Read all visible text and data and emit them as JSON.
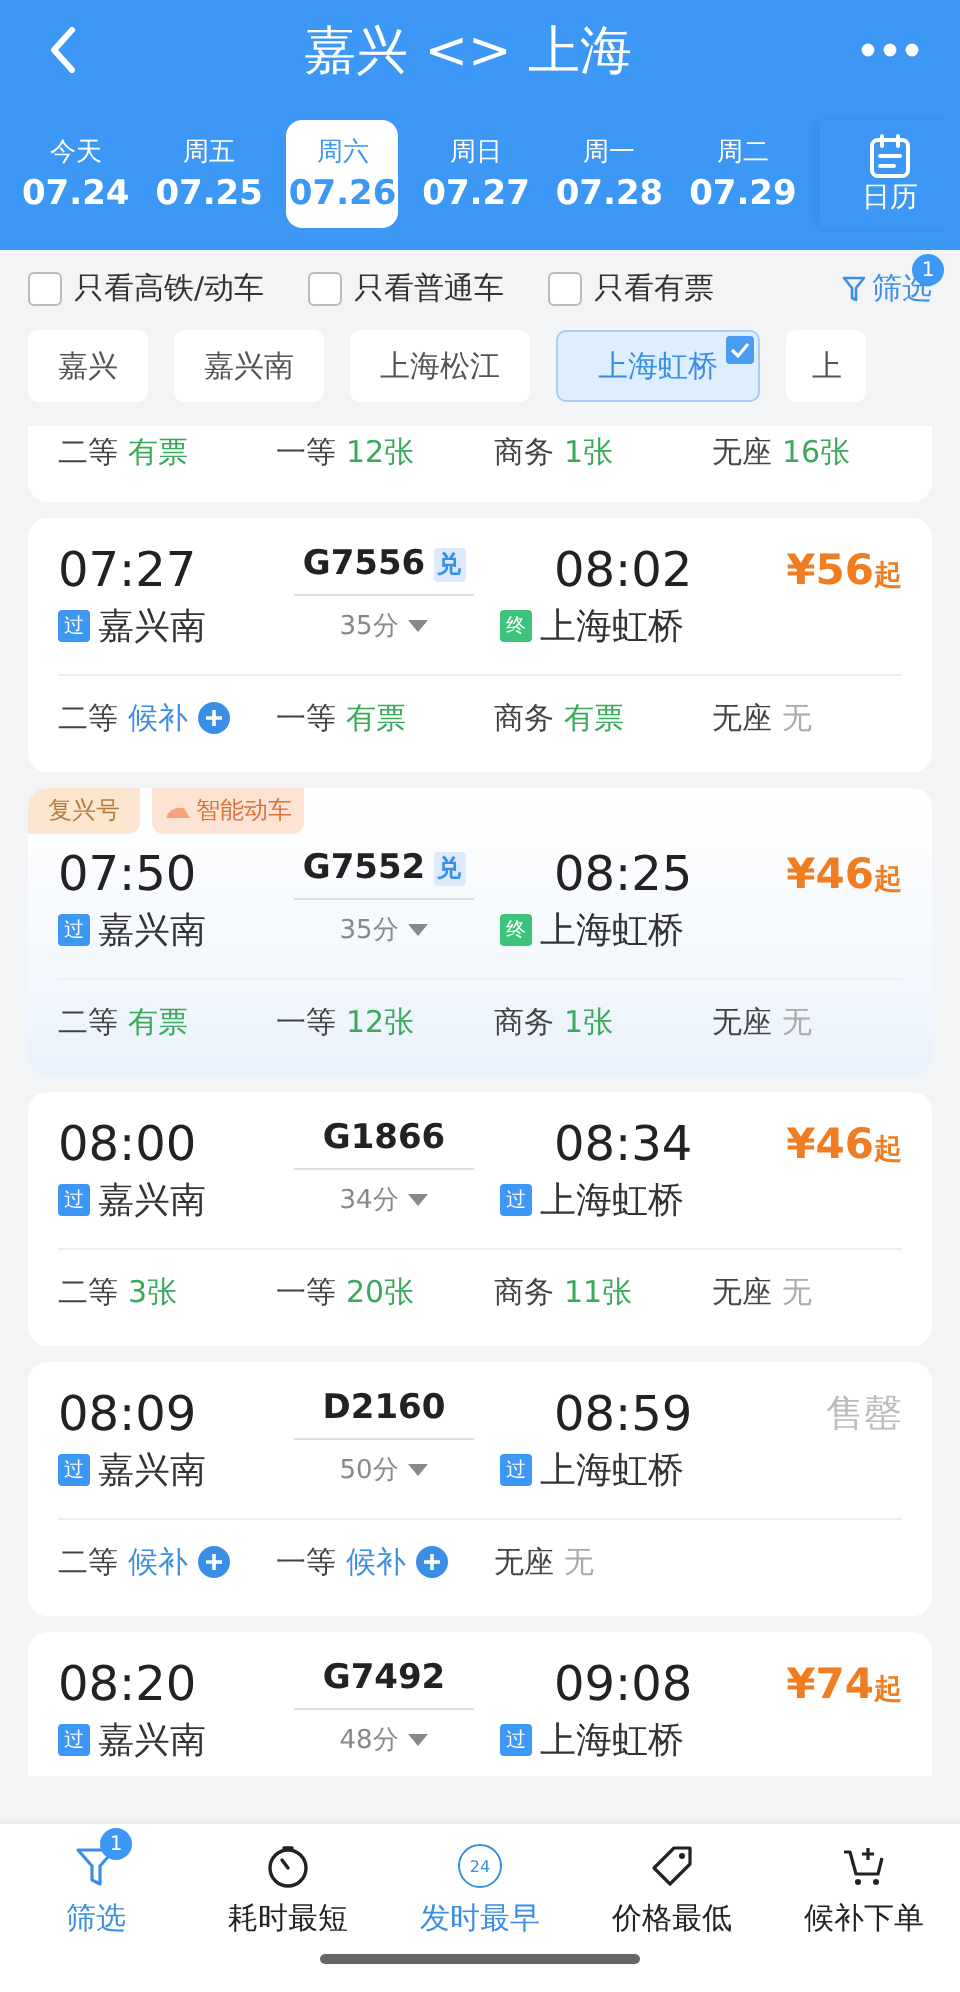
{
  "header": {
    "title": "嘉兴 <> 上海"
  },
  "dates": [
    {
      "weekday": "今天",
      "date": "07.24",
      "selected": false
    },
    {
      "weekday": "周五",
      "date": "07.25",
      "selected": false
    },
    {
      "weekday": "周六",
      "date": "07.26",
      "selected": true
    },
    {
      "weekday": "周日",
      "date": "07.27",
      "selected": false
    },
    {
      "weekday": "周一",
      "date": "07.28",
      "selected": false
    },
    {
      "weekday": "周二",
      "date": "07.29",
      "selected": false
    }
  ],
  "calendar": {
    "label": "日历"
  },
  "quick_filters": [
    {
      "label": "只看高铁/动车",
      "checked": false
    },
    {
      "label": "只看普通车",
      "checked": false
    },
    {
      "label": "只看有票",
      "checked": false
    }
  ],
  "filter_button": {
    "label": "筛选",
    "badge": "1"
  },
  "stations": [
    {
      "label": "嘉兴",
      "selected": false
    },
    {
      "label": "嘉兴南",
      "selected": false
    },
    {
      "label": "上海松江",
      "selected": false
    },
    {
      "label": "上海虹桥",
      "selected": true
    },
    {
      "label": "上",
      "selected": false
    }
  ],
  "trains": [
    {
      "seats": [
        {
          "class": "二等",
          "status": "有票",
          "kind": "available"
        },
        {
          "class": "一等",
          "status": "12张",
          "kind": "available"
        },
        {
          "class": "商务",
          "status": "1张",
          "kind": "available"
        },
        {
          "class": "无座",
          "status": "16张",
          "kind": "available"
        }
      ]
    },
    {
      "depart": "07:27",
      "number": "G7556",
      "redeem": "兑",
      "arrive": "08:02",
      "from": {
        "badge": "过",
        "kind": "pass",
        "name": "嘉兴南"
      },
      "duration": "35分",
      "to": {
        "badge": "终",
        "kind": "end",
        "name": "上海虹桥"
      },
      "price": {
        "kind": "price",
        "amount": "¥56",
        "suffix": "起"
      },
      "seats": [
        {
          "class": "二等",
          "status": "候补",
          "kind": "waitlist"
        },
        {
          "class": "一等",
          "status": "有票",
          "kind": "available"
        },
        {
          "class": "商务",
          "status": "有票",
          "kind": "available"
        },
        {
          "class": "无座",
          "status": "无",
          "kind": "none"
        }
      ]
    },
    {
      "tags": [
        {
          "label": "复兴号",
          "kind": "plain"
        },
        {
          "label": "智能动车",
          "kind": "smart"
        }
      ],
      "depart": "07:50",
      "number": "G7552",
      "redeem": "兑",
      "arrive": "08:25",
      "from": {
        "badge": "过",
        "kind": "pass",
        "name": "嘉兴南"
      },
      "duration": "35分",
      "to": {
        "badge": "终",
        "kind": "end",
        "name": "上海虹桥"
      },
      "price": {
        "kind": "price",
        "amount": "¥46",
        "suffix": "起"
      },
      "seats": [
        {
          "class": "二等",
          "status": "有票",
          "kind": "available"
        },
        {
          "class": "一等",
          "status": "12张",
          "kind": "available"
        },
        {
          "class": "商务",
          "status": "1张",
          "kind": "available"
        },
        {
          "class": "无座",
          "status": "无",
          "kind": "none"
        }
      ]
    },
    {
      "depart": "08:00",
      "number": "G1866",
      "arrive": "08:34",
      "from": {
        "badge": "过",
        "kind": "pass",
        "name": "嘉兴南"
      },
      "duration": "34分",
      "to": {
        "badge": "过",
        "kind": "pass",
        "name": "上海虹桥"
      },
      "price": {
        "kind": "price",
        "amount": "¥46",
        "suffix": "起"
      },
      "seats": [
        {
          "class": "二等",
          "status": "3张",
          "kind": "available"
        },
        {
          "class": "一等",
          "status": "20张",
          "kind": "available"
        },
        {
          "class": "商务",
          "status": "11张",
          "kind": "available"
        },
        {
          "class": "无座",
          "status": "无",
          "kind": "none"
        }
      ]
    },
    {
      "depart": "08:09",
      "number": "D2160",
      "arrive": "08:59",
      "from": {
        "badge": "过",
        "kind": "pass",
        "name": "嘉兴南"
      },
      "duration": "50分",
      "to": {
        "badge": "过",
        "kind": "pass",
        "name": "上海虹桥"
      },
      "price": {
        "kind": "sold_out",
        "text": "售罄"
      },
      "seats": [
        {
          "class": "二等",
          "status": "候补",
          "kind": "waitlist"
        },
        {
          "class": "一等",
          "status": "候补",
          "kind": "waitlist"
        },
        {
          "class": "无座",
          "status": "无",
          "kind": "none"
        }
      ]
    },
    {
      "depart": "08:20",
      "number": "G7492",
      "arrive": "09:08",
      "from": {
        "badge": "过",
        "kind": "pass",
        "name": "嘉兴南"
      },
      "duration": "48分",
      "to": {
        "badge": "过",
        "kind": "pass",
        "name": "上海虹桥"
      },
      "price": {
        "kind": "price",
        "amount": "¥74",
        "suffix": "起"
      }
    }
  ],
  "bottom_bar": [
    {
      "label": "筛选",
      "kind": "filter",
      "badge": "1",
      "selected": true
    },
    {
      "label": "耗时最短",
      "kind": "timer",
      "selected": false
    },
    {
      "label": "发时最早",
      "kind": "clock",
      "icon_text": "24",
      "selected": true
    },
    {
      "label": "价格最低",
      "kind": "tag",
      "selected": false
    },
    {
      "label": "候补下单",
      "kind": "cart",
      "selected": false
    }
  ]
}
